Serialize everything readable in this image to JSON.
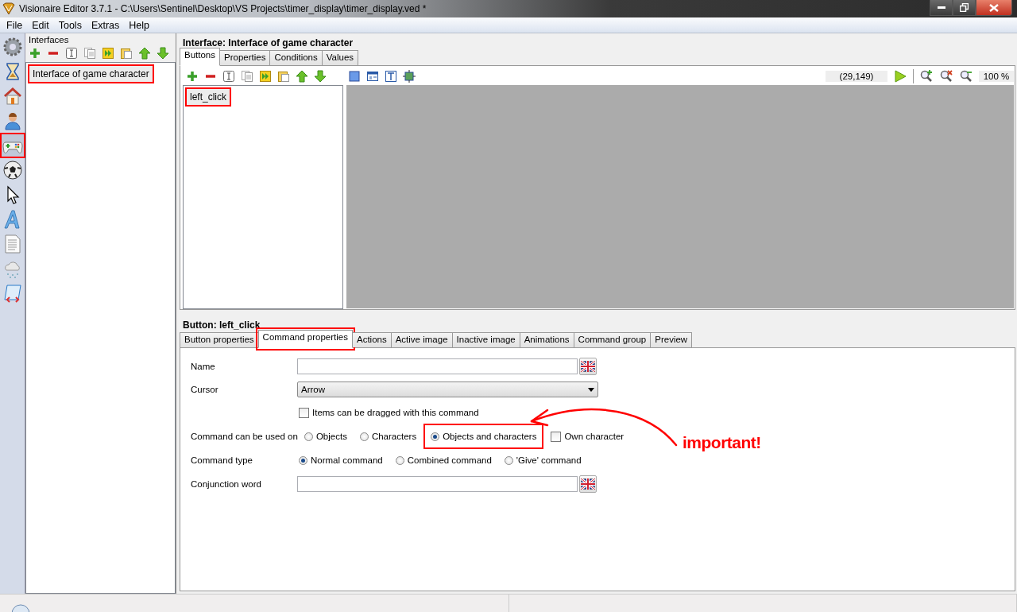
{
  "window": {
    "title": "Visionaire Editor 3.7.1 - C:\\Users\\Sentinel\\Desktop\\VS Projects\\timer_display\\timer_display.ved *"
  },
  "menu": [
    "File",
    "Edit",
    "Tools",
    "Extras",
    "Help"
  ],
  "sidebar": {
    "items": [
      {
        "kind": "gear",
        "selected": false,
        "highlighted": false
      },
      {
        "kind": "hourglass",
        "selected": false,
        "highlighted": false
      },
      {
        "kind": "house",
        "selected": false,
        "highlighted": false
      },
      {
        "kind": "person",
        "selected": false,
        "highlighted": false
      },
      {
        "kind": "gamepad",
        "selected": true,
        "highlighted": true
      },
      {
        "kind": "ball",
        "selected": false,
        "highlighted": false
      },
      {
        "kind": "cursor",
        "selected": false,
        "highlighted": false
      },
      {
        "kind": "letter",
        "selected": false,
        "highlighted": false
      },
      {
        "kind": "document",
        "selected": false,
        "highlighted": false
      },
      {
        "kind": "weather",
        "selected": false,
        "highlighted": false
      },
      {
        "kind": "script",
        "selected": false,
        "highlighted": false
      }
    ]
  },
  "interfaces": {
    "title": "Interfaces",
    "items": [
      {
        "label": "Interface of game character",
        "selected": true,
        "highlighted": true
      }
    ]
  },
  "interface_editor": {
    "title": "Interface: Interface of game character",
    "tabs": [
      {
        "label": "Buttons",
        "selected": true,
        "highlighted": false
      },
      {
        "label": "Properties",
        "selected": false,
        "highlighted": false
      },
      {
        "label": "Conditions",
        "selected": false,
        "highlighted": false
      },
      {
        "label": "Values",
        "selected": false,
        "highlighted": false
      }
    ],
    "buttons": [
      {
        "label": "left_click",
        "selected": true,
        "highlighted": true
      }
    ],
    "coordinates": "(29,149)",
    "zoom": "100 %"
  },
  "button_editor": {
    "title": "Button: left_click",
    "tabs": [
      {
        "label": "Button properties",
        "selected": false,
        "highlighted": false
      },
      {
        "label": "Command properties",
        "selected": true,
        "highlighted": true
      },
      {
        "label": "Actions",
        "selected": false,
        "highlighted": false
      },
      {
        "label": "Active image",
        "selected": false,
        "highlighted": false
      },
      {
        "label": "Inactive image",
        "selected": false,
        "highlighted": false
      },
      {
        "label": "Animations",
        "selected": false,
        "highlighted": false
      },
      {
        "label": "Command group",
        "selected": false,
        "highlighted": false
      },
      {
        "label": "Preview",
        "selected": false,
        "highlighted": false
      }
    ],
    "form": [
      {
        "kind": "text",
        "label": "Name"
      },
      {
        "kind": "dropdown",
        "label": "Cursor",
        "value": "Arrow"
      },
      {
        "kind": "checkbox",
        "text": "Items can be dragged with this command",
        "checked": false
      },
      {
        "kind": "choices",
        "label": "Command can be used on",
        "options": [
          {
            "kind": "radio",
            "label": "Objects",
            "selected": false,
            "highlighted": false
          },
          {
            "kind": "radio",
            "label": "Characters",
            "selected": false,
            "highlighted": false
          },
          {
            "kind": "radio",
            "label": "Objects and characters",
            "selected": true,
            "highlighted": true
          },
          {
            "kind": "checkbox",
            "label": "Own character",
            "checked": false,
            "highlighted": false
          }
        ]
      },
      {
        "kind": "choices",
        "label": "Command type",
        "options": [
          {
            "kind": "radio",
            "label": "Normal command",
            "selected": true,
            "highlighted": false
          },
          {
            "kind": "radio",
            "label": "Combined command",
            "selected": false,
            "highlighted": false
          },
          {
            "kind": "radio",
            "label": "'Give' command",
            "selected": false,
            "highlighted": false
          }
        ]
      },
      {
        "kind": "text",
        "label": "Conjunction word"
      }
    ]
  },
  "annotation": {
    "text": "important!"
  }
}
